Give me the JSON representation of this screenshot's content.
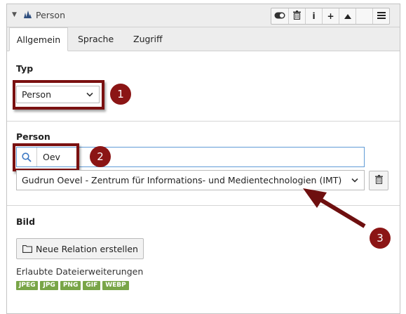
{
  "header": {
    "title": "Person"
  },
  "tabs": [
    {
      "label": "Allgemein"
    },
    {
      "label": "Sprache"
    },
    {
      "label": "Zugriff"
    }
  ],
  "typ": {
    "label": "Typ",
    "value": "Person"
  },
  "person": {
    "label": "Person",
    "search_value": "Oev",
    "selected": "Gudrun Oevel - Zentrum für Informations- und Medientechnologien (IMT)"
  },
  "bild": {
    "label": "Bild",
    "button_label": "Neue Relation erstellen",
    "allowed_label": "Erlaubte Dateierweiterungen",
    "extensions": [
      "JPEG",
      "JPG",
      "PNG",
      "GIF",
      "WEBP"
    ]
  },
  "annotations": {
    "one": "1",
    "two": "2",
    "three": "3"
  },
  "colors": {
    "annotation": "#7a1010",
    "badge": "#8b1515",
    "extension": "#79a548",
    "search_border": "#5f9bd6"
  }
}
